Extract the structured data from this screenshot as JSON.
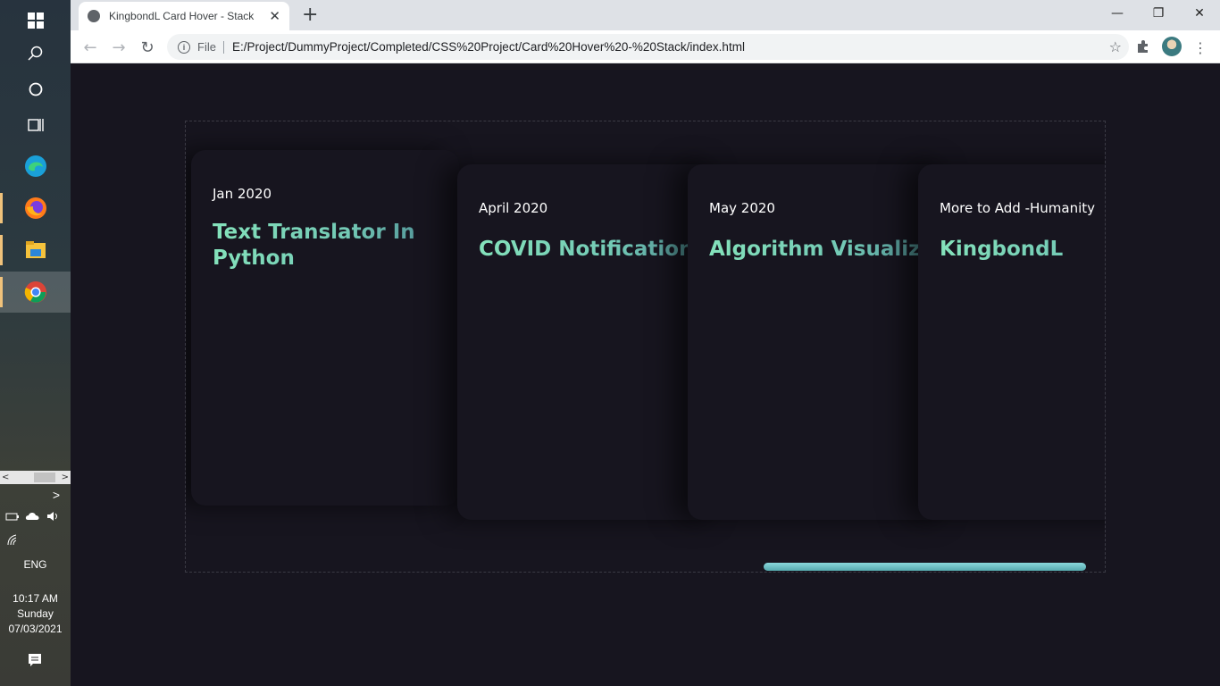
{
  "taskbar": {
    "icons": [
      "windows-start-icon",
      "search-icon",
      "cortana-icon",
      "task-view-icon",
      "edge-icon",
      "firefox-icon",
      "file-explorer-icon",
      "chrome-icon"
    ],
    "language": "ENG",
    "time": "10:17 AM",
    "day": "Sunday",
    "date": "07/03/2021",
    "scroll_left": "<",
    "scroll_right": ">",
    "chevron": ">"
  },
  "browser": {
    "tab_title": "KingbondL Card Hover - Stack",
    "tab_close": "✕",
    "new_tab": "+",
    "win_minimize": "—",
    "win_restore": "❐",
    "win_close": "✕",
    "back": "←",
    "forward": "→",
    "reload": "↻",
    "scheme_label": "File",
    "url": "E:/Project/DummyProject/Completed/CSS%20Project/Card%20Hover%20-%20Stack/index.html",
    "star": "☆",
    "menu": "⋮"
  },
  "cards": [
    {
      "date": "Jan 2020",
      "title": "Text Translator In Python"
    },
    {
      "date": "April 2020",
      "title": "COVID Notifications"
    },
    {
      "date": "May 2020",
      "title": "Algorithm Visualizer"
    },
    {
      "date": "More to Add -Humanity",
      "title": "KingbondL"
    }
  ],
  "colors": {
    "page_bg": "#17151f",
    "card_bg": "#17151f",
    "title_gradient_start": "#84e2bb",
    "title_gradient_end": "#4e8e95",
    "scrollbar": "#6bbfc4"
  }
}
